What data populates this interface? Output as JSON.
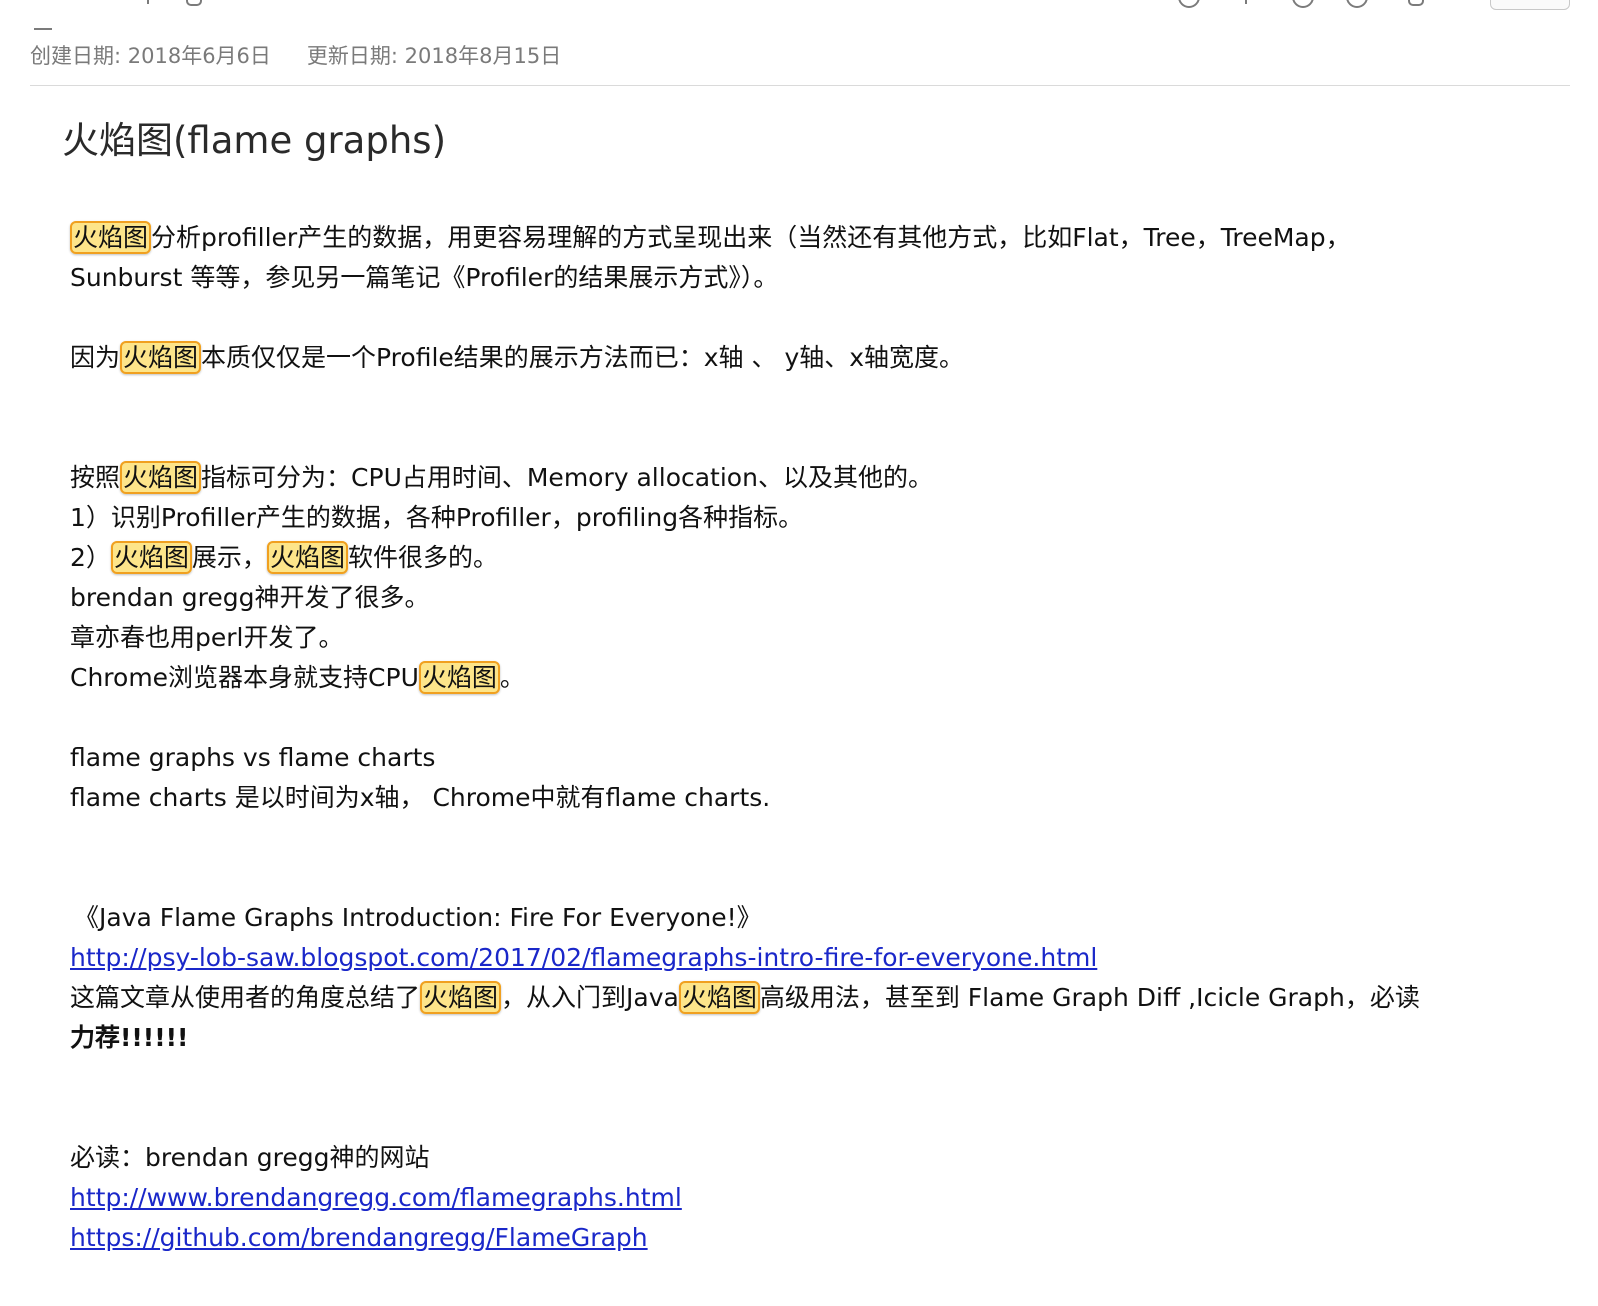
{
  "meta": {
    "created": "创建日期: 2018年6月6日",
    "updated": "更新日期: 2018年8月15日"
  },
  "note": {
    "title": "火焰图(flame graphs)",
    "highlight_term": "火焰图",
    "p1": {
      "rest_line1": "分析profiller产生的数据，用更容易理解的方式呈现出来（当然还有其他方式，比如Flat，Tree，TreeMap，",
      "line2": "Sunburst 等等，参见另一篇笔记《Profiler的结果展示方式》）。"
    },
    "p2": {
      "pre": "因为",
      "post": "本质仅仅是一个Profile结果的展示方法而已：x轴 、 y轴、x轴宽度。"
    },
    "p3": {
      "pre": "按照",
      "post": "指标可分为：CPU占用时间、Memory allocation、以及其他的。"
    },
    "l1": "1）识别Profiller产生的数据，各种Profiller，profiling各种指标。",
    "l2": {
      "pre": "2）",
      "mid": "展示，",
      "post": "软件很多的。"
    },
    "l3": "brendan gregg神开发了很多。",
    "l4": "章亦春也用perl开发了。",
    "l5": {
      "pre": "Chrome浏览器本身就支持CPU",
      "post": "。"
    },
    "fg1": "flame graphs  vs  flame charts",
    "fg2": "flame charts 是以时间为x轴， Chrome中就有flame charts.",
    "article_title": "《Java Flame Graphs Introduction: Fire For Everyone!》",
    "article_link": "http://psy-lob-saw.blogspot.com/2017/02/flamegraphs-intro-fire-for-everyone.html",
    "article_desc": {
      "pre": "这篇文章从使用者的角度总结了",
      "mid": "，从入门到Java",
      "post": "高级用法，甚至到 Flame Graph Diff ,Icicle Graph，必读",
      "bold": "力荐!!!!!!"
    },
    "must_read": "必读：brendan gregg神的网站",
    "link2": "http://www.brendangregg.com/flamegraphs.html",
    "link3": "https://github.com/brendangregg/FlameGraph"
  }
}
